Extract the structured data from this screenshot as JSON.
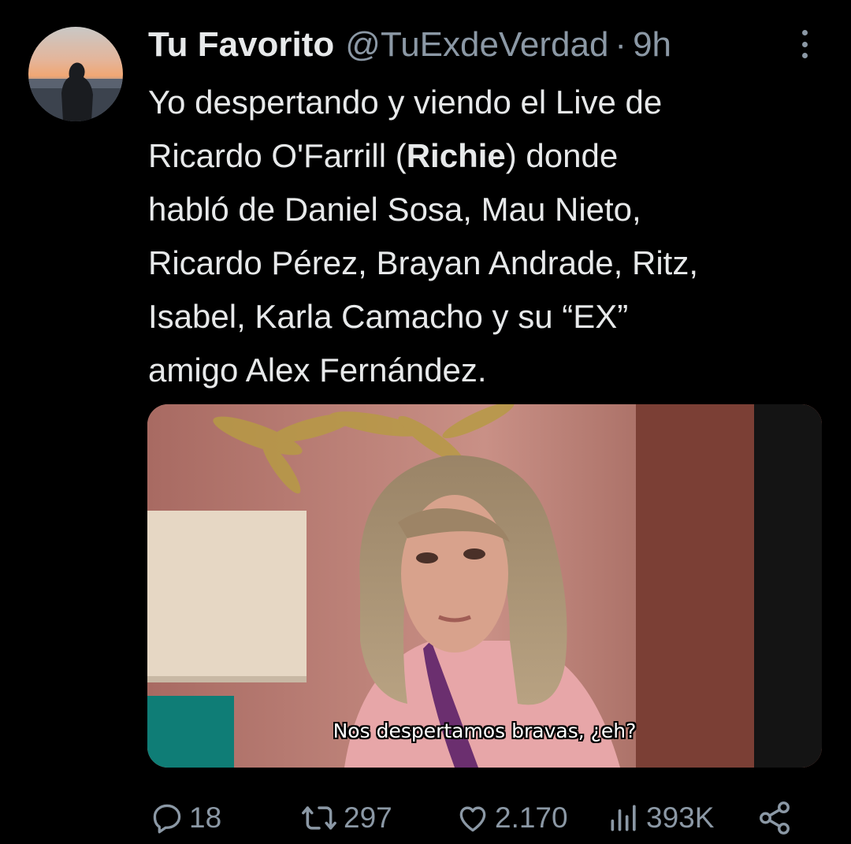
{
  "tweet": {
    "author": {
      "display_name": "Tu Favorito",
      "handle": "@TuExdeVerdad",
      "separator": "·",
      "time": "9h"
    },
    "text_lines": [
      "Yo despertando y viendo el Live de",
      [
        "Ricardo O'Farrill (",
        "Richie",
        ") donde"
      ],
      "habló de Daniel Sosa, Mau Nieto,",
      "Ricardo Pérez, Brayan Andrade, Ritz,",
      "Isabel, Karla Camacho y su “EX”",
      "amigo Alex Fernández."
    ],
    "media": {
      "subtitle": "Nos despertamos bravas, ¿eh?"
    },
    "actions": {
      "replies": "18",
      "retweets": "297",
      "likes": "2.170",
      "views": "393K"
    }
  },
  "icons": {
    "reply": "reply-icon",
    "retweet": "retweet-icon",
    "like": "heart-icon",
    "views": "views-icon",
    "share": "share-icon",
    "more": "more-icon"
  },
  "colors": {
    "background": "#000000",
    "text": "#e7e9ea",
    "secondary": "#8b98a5"
  }
}
